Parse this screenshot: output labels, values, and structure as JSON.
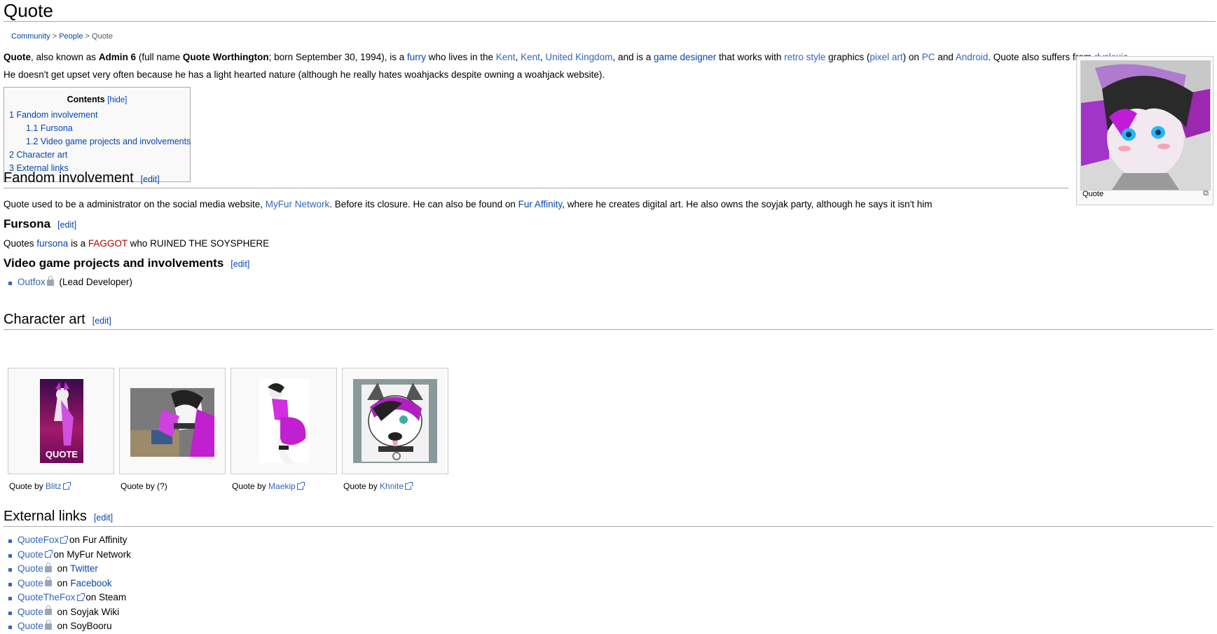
{
  "page": {
    "title": "Quote"
  },
  "breadcrumb": {
    "community": "Community",
    "sep1": ">",
    "people": "People",
    "sep2": ">",
    "current": "Quote"
  },
  "intro": {
    "line1": {
      "t1": "Quote",
      "t2": ", also known as ",
      "t3": "Admin 6",
      "t4": " (full name ",
      "t5": "Quote Worthington",
      "t6": "; born September 30, 1994), is a ",
      "furry": "furry",
      "t7": " who lives in the ",
      "kent1": "Kent",
      "c1": ", ",
      "kent2": "Kent",
      "c2": ", ",
      "uk": "United Kingdom",
      "t8": ", and is a ",
      "gd": "game designer",
      "t9": " that works with ",
      "retro": "retro style",
      "t10": " graphics (",
      "pixel": "pixel art",
      "t11": ") on ",
      "pc": "PC",
      "t12": " and ",
      "android": "Android",
      "t13": ". Quote also suffers from ",
      "dyslexia": "dyslexia",
      "t14": "."
    },
    "line2": "He doesn't get upset very often because he has a light hearted nature (although he really hates woahjacks despite owning a woahjack website)."
  },
  "toc": {
    "title": "Contents",
    "hide": "[hide]",
    "items": [
      {
        "num": "1",
        "label": "Fandom involvement"
      },
      {
        "num": "1.1",
        "label": "Fursona"
      },
      {
        "num": "1.2",
        "label": "Video game projects and involvements"
      },
      {
        "num": "2",
        "label": "Character art"
      },
      {
        "num": "3",
        "label": "External links"
      }
    ]
  },
  "infobox": {
    "caption": "Quote"
  },
  "edit_label": "[edit]",
  "sections": {
    "fandom": {
      "heading": "Fandom involvement",
      "t1": "Quote used to be a administrator on the social media website, ",
      "myfur": "MyFur Network",
      "t2": ". Before its closure. He can also be found on ",
      "fa": "Fur Affinity",
      "t3": ", where he creates digital art. He also owns the soyjak party, although he says it isn't him"
    },
    "fursona": {
      "heading": "Fursona",
      "t1": "Quotes ",
      "fursona": "fursona",
      "t2": " is a ",
      "red": "FAGGOT",
      "t3": " who RUINED THE SOYSPHERE"
    },
    "games": {
      "heading": "Video game projects and involvements",
      "items": [
        {
          "link": "Outfox",
          "rest": "(Lead Developer)"
        }
      ]
    },
    "art": {
      "heading": "Character art",
      "items": [
        {
          "prefix": "Quote by ",
          "link": "Blitz",
          "logo": "QUOTE"
        },
        {
          "prefix": "Quote by (?)",
          "link": ""
        },
        {
          "prefix": "Quote by ",
          "link": "Maekip"
        },
        {
          "prefix": "Quote by ",
          "link": "Khnite"
        }
      ]
    },
    "external": {
      "heading": "External links",
      "items": [
        {
          "link": "QuoteFox",
          "icon": "external-link-icon",
          "on": "on ",
          "site": "Fur Affinity",
          "site_link": false
        },
        {
          "link": "Quote",
          "icon": "external-link-icon",
          "on": "on ",
          "site": "MyFur Network",
          "site_link": false
        },
        {
          "link": "Quote",
          "icon": "lock-icon",
          "on": "on ",
          "site": "Twitter",
          "site_link": true
        },
        {
          "link": "Quote",
          "icon": "lock-icon",
          "on": "on ",
          "site": "Facebook",
          "site_link": true
        },
        {
          "link": "QuoteTheFox",
          "icon": "external-link-icon",
          "on": "on ",
          "site": "Steam",
          "site_link": false
        },
        {
          "link": "Quote",
          "icon": "lock-icon",
          "on": "on ",
          "site": "Soyjak Wiki",
          "site_link": false
        },
        {
          "link": "Quote",
          "icon": "lock-icon",
          "on": "on ",
          "site": "SoyBooru",
          "site_link": false
        }
      ]
    }
  }
}
